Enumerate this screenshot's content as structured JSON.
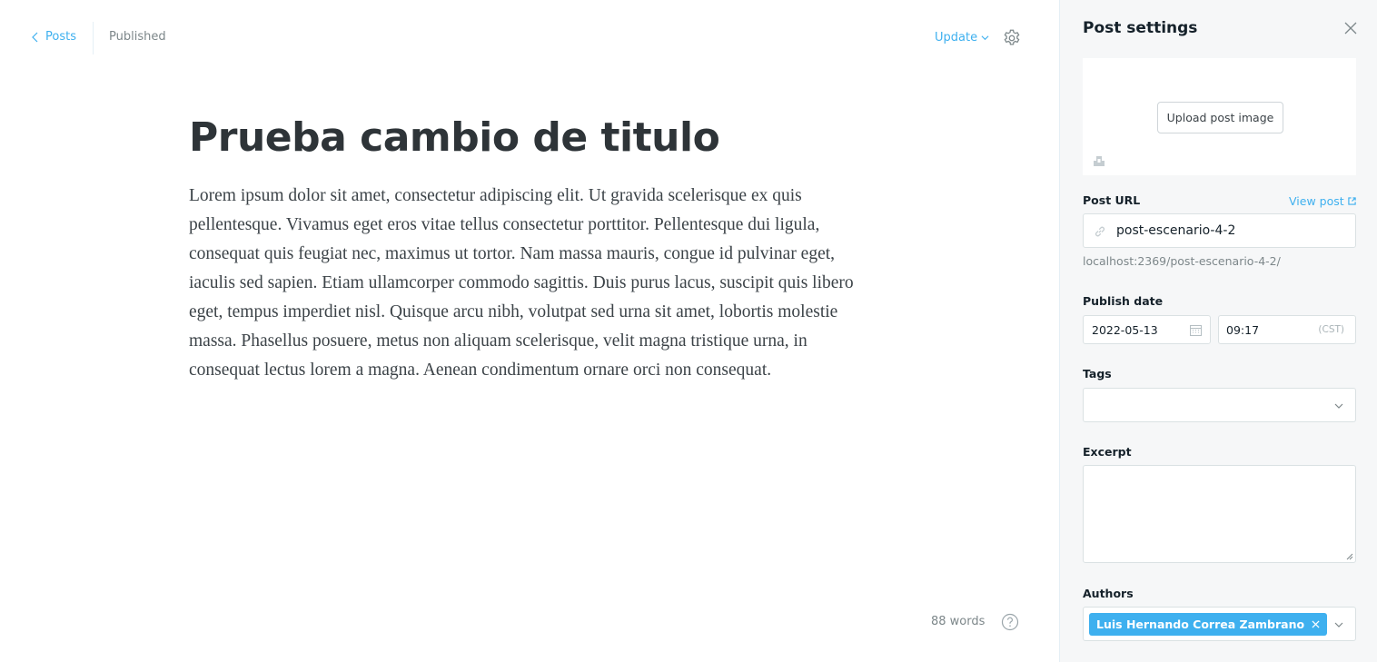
{
  "header": {
    "back_label": "Posts",
    "status": "Published",
    "update_label": "Update"
  },
  "post": {
    "title": "Prueba cambio de titulo",
    "body": "Lorem ipsum dolor sit amet, consectetur adipiscing elit. Ut gravida scelerisque ex quis pellentesque. Vivamus eget eros vitae tellus consectetur porttitor. Pellentesque dui ligula, consequat quis feugiat nec, maximus ut tortor. Nam massa mauris, congue id pulvinar eget, iaculis sed sapien. Etiam ullamcorper commodo sagittis. Duis purus lacus, suscipit quis libero eget, tempus imperdiet nisl. Quisque arcu nibh, volutpat sed urna sit amet, lobortis molestie massa. Phasellus posuere, metus non aliquam scelerisque, velit magna tristique urna, in consequat lectus lorem a magna. Aenean condimentum ornare orci non consequat.",
    "word_count": "88 words"
  },
  "settings": {
    "title": "Post settings",
    "upload_label": "Upload post image",
    "post_url_label": "Post URL",
    "view_post_label": "View post",
    "slug": "post-escenario-4-2",
    "url_preview": "localhost:2369/post-escenario-4-2/",
    "publish_date_label": "Publish date",
    "date": "2022-05-13",
    "time": "09:17",
    "timezone": "(CST)",
    "tags_label": "Tags",
    "excerpt_label": "Excerpt",
    "authors_label": "Authors",
    "author_name": "Luis Hernando Correa Zambrano"
  },
  "colors": {
    "accent": "#3eb0ef",
    "panel_bg": "#f6f7f8",
    "text_dark": "#15212a",
    "muted": "#7d878a"
  },
  "icons": [
    "chevron-left-icon",
    "chevron-down-icon",
    "gear-icon",
    "help-icon",
    "close-icon",
    "image-icon",
    "external-link-icon",
    "link-icon",
    "calendar-icon",
    "remove-author-icon"
  ]
}
